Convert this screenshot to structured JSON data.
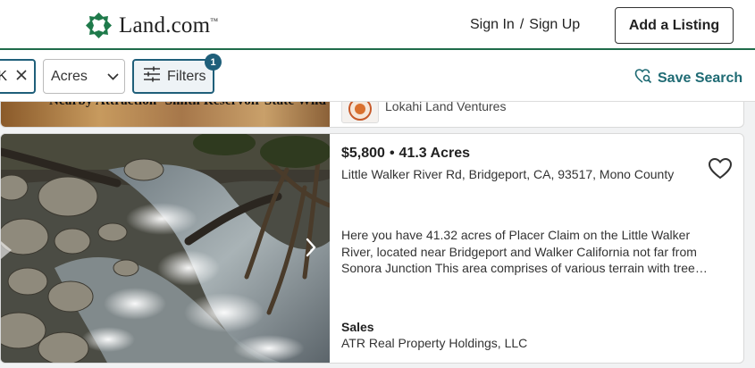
{
  "header": {
    "brand": "Land.com",
    "brand_tm": "™",
    "sign_in": "Sign In",
    "separator": "/",
    "sign_up": "Sign Up",
    "add_listing": "Add a Listing"
  },
  "filters": {
    "chip_text": "K",
    "acres_select": "Acres",
    "filters_label": "Filters",
    "filters_count": "1",
    "save_search": "Save Search"
  },
  "previous_listing": {
    "image_caption": "Nearby Attraction- Smith Reservoir State Wild",
    "seller": "Lokahi Land Ventures"
  },
  "listing": {
    "price": "$5,800",
    "bullet": "•",
    "acres": "41.3 Acres",
    "address": "Little Walker River Rd, Bridgeport, CA, 93517, Mono County",
    "description": "Here you have 41.32 acres of Placer Claim on the Little Walker River, located near Bridgeport and Walker California not far from Sonora Junction This area comprises of various terrain with tree…",
    "category": "Sales",
    "seller": "ATR Real Property Holdings, LLC"
  },
  "icons": {
    "logo": "land-leaf-logo-icon",
    "remove": "close-icon",
    "dropdown": "chevron-down-icon",
    "filters": "sliders-icon",
    "save": "heart-search-icon",
    "favorite": "heart-icon",
    "next": "chevron-right-icon"
  },
  "colors": {
    "brand_green": "#1f6b4a",
    "accent_teal": "#1f5f7a"
  }
}
